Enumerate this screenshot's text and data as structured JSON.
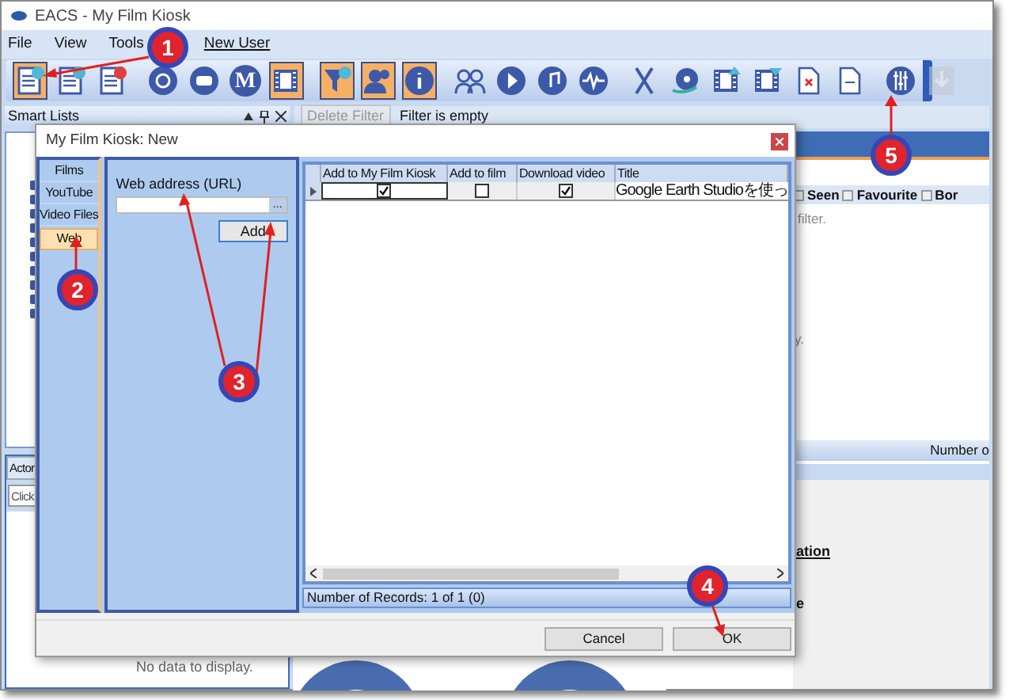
{
  "window": {
    "title": "EACS - My Film Kiosk"
  },
  "menu": [
    "File",
    "View",
    "Tools"
  ],
  "user_link": "New User",
  "toolbar": [
    {
      "kind": "doc-add",
      "highlighted": true
    },
    {
      "kind": "doc-edit",
      "highlighted": false
    },
    {
      "kind": "doc-delete",
      "highlighted": false
    },
    {
      "kind": "separator"
    },
    {
      "kind": "disc-search",
      "highlighted": false
    },
    {
      "kind": "video-logo",
      "highlighted": false
    },
    {
      "kind": "letter",
      "label": "M",
      "highlighted": false
    },
    {
      "kind": "film",
      "highlighted": true
    },
    {
      "kind": "separator"
    },
    {
      "kind": "filter",
      "highlighted": true
    },
    {
      "kind": "person",
      "highlighted": true
    },
    {
      "kind": "info",
      "highlighted": true
    },
    {
      "kind": "separator"
    },
    {
      "kind": "people",
      "highlighted": false
    },
    {
      "kind": "play",
      "highlighted": false
    },
    {
      "kind": "music",
      "highlighted": false
    },
    {
      "kind": "wave",
      "highlighted": false
    },
    {
      "kind": "separator"
    },
    {
      "kind": "scissors",
      "highlighted": false
    },
    {
      "kind": "disc",
      "highlighted": false
    },
    {
      "kind": "film-up",
      "highlighted": false
    },
    {
      "kind": "film-down",
      "highlighted": false
    },
    {
      "kind": "file-x",
      "highlighted": false
    },
    {
      "kind": "file",
      "highlighted": false
    },
    {
      "kind": "separator"
    },
    {
      "kind": "sliders",
      "highlighted": false
    },
    {
      "kind": "download",
      "highlighted": false,
      "disabled": true
    }
  ],
  "smart_lists": {
    "title": "Smart Lists"
  },
  "filter_bar": {
    "button": "Delete Filter",
    "button_disabled": true,
    "status": "Filter is empty"
  },
  "grid_header": [
    "Seen",
    "Favourite",
    "Bor"
  ],
  "filter_hint": "filter.",
  "hint_tail": "y.",
  "record_bar": "Number o",
  "details": [
    "ation",
    "e"
  ],
  "actors": {
    "tab": "Actor",
    "search_placeholder": "Click",
    "empty": "No data to display."
  },
  "dialog": {
    "title": "My Film Kiosk: New",
    "sources": [
      {
        "label": "Films",
        "selected": false
      },
      {
        "label": "YouTube",
        "selected": false
      },
      {
        "label": "Video Files",
        "selected": false
      },
      {
        "label": "Web",
        "selected": true
      }
    ],
    "url_label": "Web address (URL)",
    "browse": "...",
    "add": "Add",
    "columns": [
      "Add to My Film Kiosk",
      "Add to film",
      "Download video",
      "Title"
    ],
    "rows": [
      {
        "add_to_kiosk": true,
        "add_to_film": false,
        "download": true,
        "title": "Google Earth Studioを使っ"
      }
    ],
    "records": "Number of Records: 1 of 1 (0)",
    "buttons": [
      "Cancel",
      "OK"
    ]
  },
  "callouts": [
    "1",
    "2",
    "3",
    "4",
    "5"
  ]
}
